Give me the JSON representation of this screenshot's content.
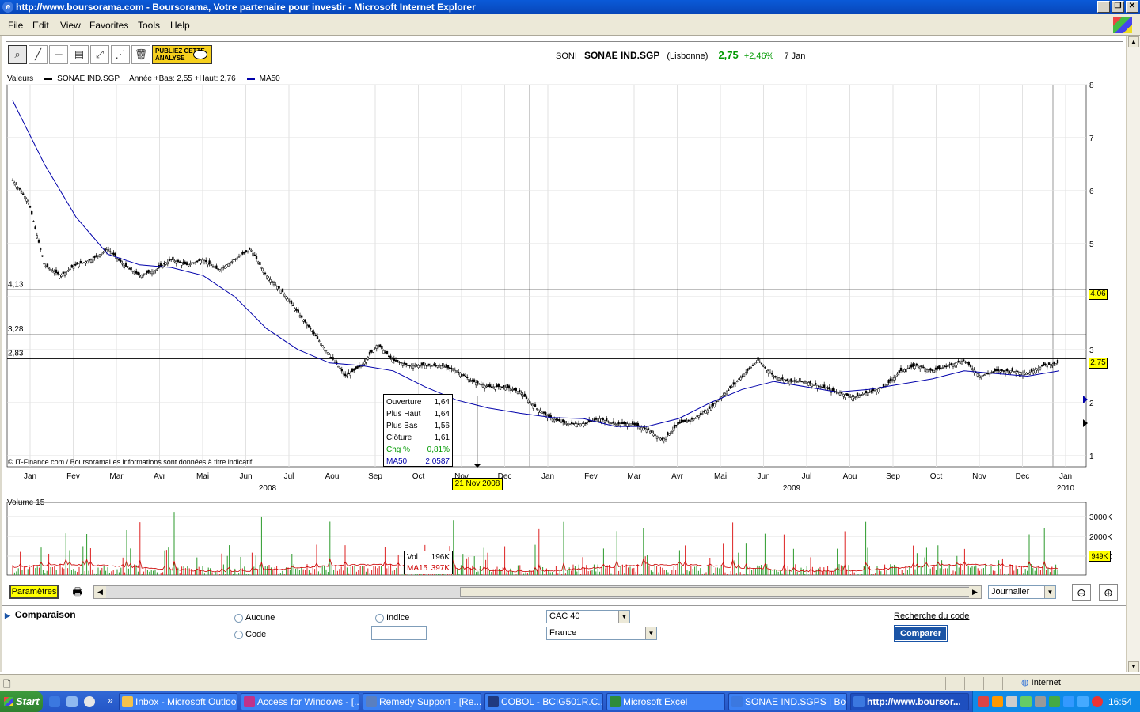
{
  "window": {
    "title": "http://www.boursorama.com - Boursorama, Votre partenaire pour investir - Microsoft Internet Explorer",
    "buttons": [
      "_",
      "❐",
      "✕"
    ]
  },
  "menu": [
    "File",
    "Edit",
    "View",
    "Favorites",
    "Tools",
    "Help"
  ],
  "toolbar": {
    "tools": [
      "zoom-tool",
      "line-tool",
      "horizontal-line-tool",
      "indicator-tool",
      "resize-tool",
      "fibonacci-tool",
      "trash-tool"
    ],
    "publiez_label": "PUBLIEZ CETTE ANALYSE"
  },
  "quote": {
    "code": "SONI",
    "name": "SONAE IND.SGP",
    "market": "(Lisbonne)",
    "price": "2,75",
    "change": "+2,46%",
    "date": "7 Jan"
  },
  "legend": {
    "label": "Valeurs",
    "series": "SONAE IND.SGP",
    "range": "Année +Bas: 2,55 +Haut: 2,76",
    "ma": "MA50"
  },
  "levels": [
    {
      "label": "4,13",
      "value": 4.13
    },
    {
      "label": "3,28",
      "value": 3.28
    },
    {
      "label": "2,83",
      "value": 2.83
    }
  ],
  "price_badges": [
    {
      "label": "4,06",
      "value": 4.06
    },
    {
      "label": "2,75",
      "value": 2.75
    }
  ],
  "tooltip": {
    "rows": [
      [
        "Ouverture",
        "1,64"
      ],
      [
        "Plus Haut",
        "1,64"
      ],
      [
        "Plus Bas",
        "1,56"
      ],
      [
        "Clôture",
        "1,61"
      ]
    ],
    "chg_label": "Chg %",
    "chg": "0,81%",
    "ma_label": "MA50",
    "ma": "2,0587"
  },
  "date_badge": "21 Nov 2008",
  "credit": "© IT-Finance.com / BoursoramaLes informations sont données à titre indicatif",
  "volume": {
    "label": "Volume 15",
    "tooltip_vol_label": "Vol",
    "tooltip_vol": "196K",
    "tooltip_ma_label": "MA15",
    "tooltip_ma": "397K",
    "badge": "949K"
  },
  "controls": {
    "param": "Paramètres",
    "period": "Journalier"
  },
  "comparaison": {
    "title": "Comparaison",
    "aucune": "Aucune",
    "code": "Code",
    "indice": "Indice",
    "index_select": "CAC 40",
    "country_select": "France",
    "search_link": "Recherche du code",
    "compare_btn": "Comparer"
  },
  "status": {
    "zone": "Internet"
  },
  "taskbar": {
    "start": "Start",
    "tasks": [
      "Inbox - Microsoft Outlook",
      "Access for Windows - [...",
      "Remedy Support - [Re...",
      "COBOL - BCIG501R.C...",
      "Microsoft Excel",
      "SONAE IND.SGPS | Bo...",
      "http://www.boursor..."
    ],
    "clock": "16:54"
  },
  "chart_data": {
    "type": "candlestick",
    "y_ticks": [
      "1",
      "2",
      "3",
      "4",
      "5",
      "6",
      "7",
      "8"
    ],
    "ylim": [
      1,
      8
    ],
    "x_months": [
      "Jan",
      "Fev",
      "Mar",
      "Avr",
      "Mai",
      "Jun",
      "Jul",
      "Aou",
      "Sep",
      "Oct",
      "Nov",
      "Dec",
      "Jan",
      "Fev",
      "Mar",
      "Avr",
      "Mai",
      "Jun",
      "Jul",
      "Aou",
      "Sep",
      "Oct",
      "Nov",
      "Dec",
      "Jan"
    ],
    "x_years": [
      "2008",
      "2009",
      "2010"
    ],
    "close_path": [
      6.2,
      5.8,
      4.6,
      4.4,
      4.6,
      4.7,
      4.9,
      4.6,
      4.4,
      4.5,
      4.7,
      4.6,
      4.7,
      4.5,
      4.7,
      4.9,
      4.4,
      4.1,
      3.7,
      3.3,
      2.9,
      2.5,
      2.7,
      3.1,
      2.8,
      2.7,
      2.7,
      2.7,
      2.6,
      2.4,
      2.3,
      2.3,
      2.2,
      1.9,
      1.7,
      1.6,
      1.6,
      1.7,
      1.6,
      1.6,
      1.5,
      1.3,
      1.6,
      1.7,
      1.9,
      2.2,
      2.5,
      2.8,
      2.5,
      2.4,
      2.4,
      2.3,
      2.2,
      2.1,
      2.2,
      2.3,
      2.6,
      2.7,
      2.6,
      2.7,
      2.8,
      2.5,
      2.6,
      2.6,
      2.55,
      2.7,
      2.75
    ],
    "ma50_path": [
      7.7,
      6.5,
      5.5,
      4.8,
      4.6,
      4.55,
      4.4,
      4.0,
      3.4,
      3.0,
      2.75,
      2.7,
      2.6,
      2.3,
      2.05,
      1.9,
      1.8,
      1.72,
      1.7,
      1.55,
      1.55,
      1.7,
      2.0,
      2.25,
      2.4,
      2.3,
      2.2,
      2.25,
      2.35,
      2.45,
      2.6,
      2.55,
      2.5,
      2.6
    ]
  }
}
